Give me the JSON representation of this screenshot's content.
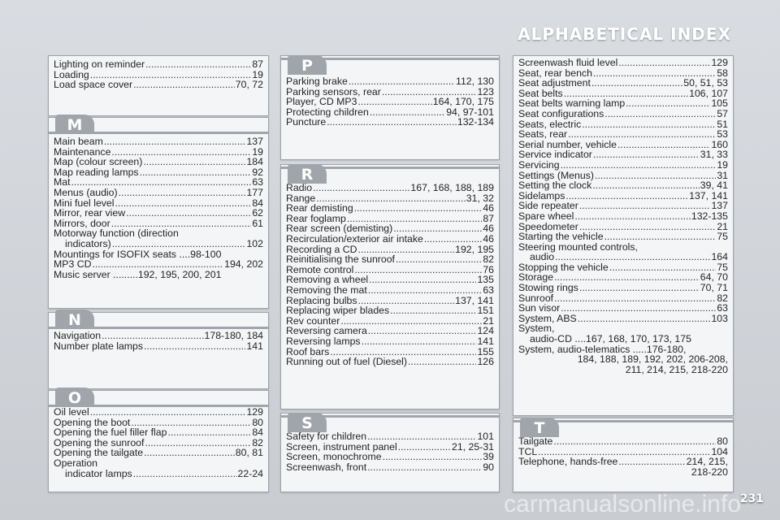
{
  "header": {
    "title": "ALPHABETICAL INDEX"
  },
  "footer": {
    "page_number": "231",
    "watermark": "carmanualsonline.info"
  },
  "sections": {
    "L": {
      "entries": [
        {
          "label": "Lighting on reminder",
          "page": "87"
        },
        {
          "label": "Loading",
          "page": "19"
        },
        {
          "label": "Load space cover",
          "page": "70, 72"
        }
      ]
    },
    "M": {
      "letter": "M",
      "entries": [
        {
          "label": "Main beam",
          "page": "137"
        },
        {
          "label": "Maintenance",
          "page": "19"
        },
        {
          "label": "Map (colour screen)",
          "page": "184"
        },
        {
          "label": "Map reading lamps",
          "page": "92"
        },
        {
          "label": "Mat",
          "page": "63"
        },
        {
          "label": "Menus (audio)",
          "page": "177"
        },
        {
          "label": "Mini fuel level",
          "page": "84"
        },
        {
          "label": "Mirror, rear view",
          "page": "62"
        },
        {
          "label": "Mirrors, door",
          "page": "61"
        },
        {
          "label": "Motorway function (direction",
          "page": ""
        },
        {
          "label": "indicators)",
          "page": "102",
          "indent": true
        },
        {
          "label": "Mountings for ISOFIX seats ....98-100",
          "page": ""
        },
        {
          "label": "MP3 CD",
          "page": "194, 202"
        },
        {
          "label": "Music server .........192, 195, 200, 201",
          "page": ""
        }
      ]
    },
    "N": {
      "letter": "N",
      "entries": [
        {
          "label": "Navigation",
          "page": "178-180, 184"
        },
        {
          "label": "Number plate lamps",
          "page": "141"
        }
      ]
    },
    "O": {
      "letter": "O",
      "entries": [
        {
          "label": "Oil level",
          "page": "129"
        },
        {
          "label": "Opening the boot",
          "page": "80"
        },
        {
          "label": "Opening the fuel filler flap",
          "page": "84"
        },
        {
          "label": "Opening the sunroof",
          "page": "82"
        },
        {
          "label": "Opening the tailgate",
          "page": "80, 81"
        },
        {
          "label": "Operation",
          "page": ""
        },
        {
          "label": "indicator lamps",
          "page": "22-24",
          "indent": true
        }
      ]
    },
    "P": {
      "letter": "P",
      "entries": [
        {
          "label": "Parking brake",
          "page": "112, 130"
        },
        {
          "label": "Parking sensors, rear",
          "page": "123"
        },
        {
          "label": "Player, CD MP3",
          "page": "164, 170, 175"
        },
        {
          "label": "Protecting children",
          "page": "94, 97-101"
        },
        {
          "label": "Puncture",
          "page": "132-134"
        }
      ]
    },
    "R": {
      "letter": "R",
      "entries": [
        {
          "label": "Radio",
          "page": "167, 168, 188, 189"
        },
        {
          "label": "Range",
          "page": "31, 32"
        },
        {
          "label": "Rear demisting",
          "page": "46"
        },
        {
          "label": "Rear foglamp",
          "page": "87"
        },
        {
          "label": "Rear screen (demisting)",
          "page": "46"
        },
        {
          "label": "Recirculation/exterior air intake",
          "page": "46"
        },
        {
          "label": "Recording a CD",
          "page": "192, 195"
        },
        {
          "label": "Reinitialising the sunroof",
          "page": "82"
        },
        {
          "label": "Remote control",
          "page": "76"
        },
        {
          "label": "Removing a wheel",
          "page": "135"
        },
        {
          "label": "Removing the mat",
          "page": "63"
        },
        {
          "label": "Replacing bulbs",
          "page": "137, 141"
        },
        {
          "label": "Replacing wiper blades",
          "page": "151"
        },
        {
          "label": "Rev counter",
          "page": "21"
        },
        {
          "label": "Reversing camera",
          "page": "124"
        },
        {
          "label": "Reversing lamps",
          "page": "141"
        },
        {
          "label": "Roof bars",
          "page": "155"
        },
        {
          "label": "Running out of fuel (Diesel)",
          "page": "126"
        }
      ]
    },
    "S_left": {
      "letter": "S",
      "entries": [
        {
          "label": "Safety for children",
          "page": "101"
        },
        {
          "label": "Screen, instrument panel",
          "page": "21, 25-31"
        },
        {
          "label": "Screen, monochrome",
          "page": "39"
        },
        {
          "label": "Screenwash, front",
          "page": "90"
        }
      ]
    },
    "S_right": {
      "entries": [
        {
          "label": "Screenwash fluid level",
          "page": "129"
        },
        {
          "label": "Seat, rear bench",
          "page": "58"
        },
        {
          "label": "Seat adjustment",
          "page": "50, 51, 53"
        },
        {
          "label": "Seat belts",
          "page": "106, 107"
        },
        {
          "label": "Seat belts warning lamp",
          "page": "105"
        },
        {
          "label": "Seat configurations",
          "page": "57"
        },
        {
          "label": "Seats, electric",
          "page": "51"
        },
        {
          "label": "Seats, rear",
          "page": "53"
        },
        {
          "label": "Serial number, vehicle",
          "page": "160"
        },
        {
          "label": "Service indicator",
          "page": "31, 33"
        },
        {
          "label": "Servicing",
          "page": "19"
        },
        {
          "label": "Settings (Menus)",
          "page": "31"
        },
        {
          "label": "Setting the clock",
          "page": "39, 41"
        },
        {
          "label": "Sidelamps",
          "page": "137, 141"
        },
        {
          "label": "Side repeater",
          "page": "137"
        },
        {
          "label": "Spare wheel",
          "page": "132-135"
        },
        {
          "label": "Speedometer",
          "page": "21"
        },
        {
          "label": "Starting the vehicle",
          "page": "75"
        },
        {
          "label": "Steering mounted controls,",
          "page": ""
        },
        {
          "label": "audio",
          "page": "164",
          "indent": true
        },
        {
          "label": "Stopping the vehicle",
          "page": "75"
        },
        {
          "label": "Storage",
          "page": "64, 70"
        },
        {
          "label": "Stowing rings",
          "page": "70, 71"
        },
        {
          "label": "Sunroof",
          "page": "82"
        },
        {
          "label": "Sun visor",
          "page": "63"
        },
        {
          "label": "System, ABS",
          "page": "103"
        },
        {
          "label": "System,",
          "page": ""
        },
        {
          "label": "audio-CD ....167, 168, 170, 173, 175",
          "page": "",
          "indent": true
        },
        {
          "label": "System, audio-telematics .....176-180,",
          "page": ""
        },
        {
          "label": "184, 188, 189, 192, 202, 206-208,",
          "page": "",
          "cont": true
        },
        {
          "label": "211, 214, 215, 218-220",
          "page": "",
          "cont": true
        }
      ]
    },
    "T": {
      "letter": "T",
      "entries": [
        {
          "label": "Tailgate",
          "page": "80"
        },
        {
          "label": "TCL",
          "page": "104"
        },
        {
          "label": "Telephone, hands-free",
          "page": "214, 215,"
        },
        {
          "label": "218-220",
          "page": "",
          "cont": true
        }
      ]
    }
  }
}
